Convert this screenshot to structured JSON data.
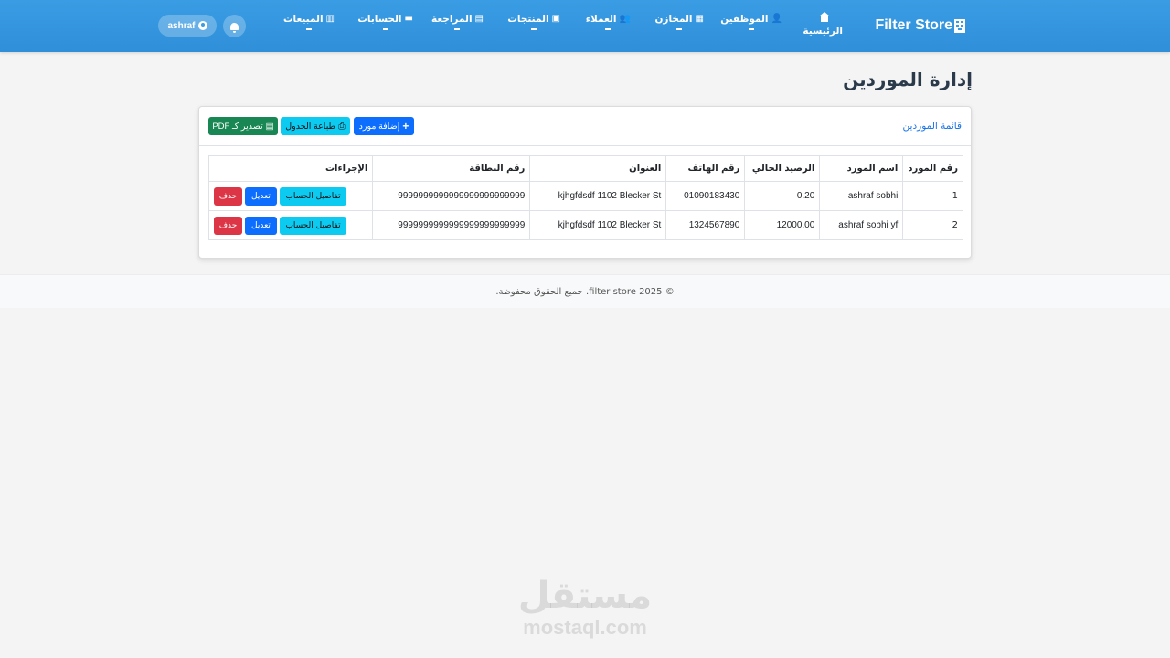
{
  "navbar": {
    "brand": "Filter Store",
    "home": "الرئيسية",
    "items": [
      {
        "label": "الموظفين",
        "icon": "user-tie-icon"
      },
      {
        "label": "المخازن",
        "icon": "warehouse-icon"
      },
      {
        "label": "العملاء",
        "icon": "users-icon"
      },
      {
        "label": "المنتجات",
        "icon": "boxes-icon"
      },
      {
        "label": "المراجعة",
        "icon": "clipboard-icon"
      },
      {
        "label": "الحسابات",
        "icon": "money-icon"
      },
      {
        "label": "المبيعات",
        "icon": "chart-icon"
      }
    ],
    "user": "ashraf"
  },
  "page": {
    "title": "إدارة الموردين"
  },
  "card": {
    "title": "قائمة الموردين",
    "add_button": "إضافة مورد",
    "print_button": "طباعة الجدول",
    "pdf_button": "تصدير كـ PDF"
  },
  "table": {
    "headers": {
      "id": "رقم المورد",
      "name": "اسم المورد",
      "balance": "الرصيد الحالي",
      "phone": "رقم الهاتف",
      "address": "العنوان",
      "card": "رقم البطاقة",
      "actions": "الإجراءات"
    },
    "rows": [
      {
        "id": "1",
        "name": "ashraf sobhi",
        "balance": "0.20",
        "phone": "01090183430",
        "address": "kjhgfdsdf 1102 Blecker St",
        "card": "9999999999999999999999999"
      },
      {
        "id": "2",
        "name": "ashraf sobhi yf",
        "balance": "12000.00",
        "phone": "1324567890",
        "address": "kjhgfdsdf 1102 Blecker St",
        "card": "9999999999999999999999999"
      }
    ],
    "actions": {
      "details": "تفاصيل الحساب",
      "edit": "تعديل",
      "delete": "حذف"
    }
  },
  "footer": {
    "text": "© 2025 filter store. جميع الحقوق محفوظة."
  },
  "watermark": {
    "arabic": "مستقل",
    "latin": "mostaql.com"
  },
  "colors": {
    "navbar": "#3a9de4",
    "primary": "#0d6efd",
    "info": "#0dcaf0",
    "success": "#198754",
    "danger": "#dc3545"
  }
}
